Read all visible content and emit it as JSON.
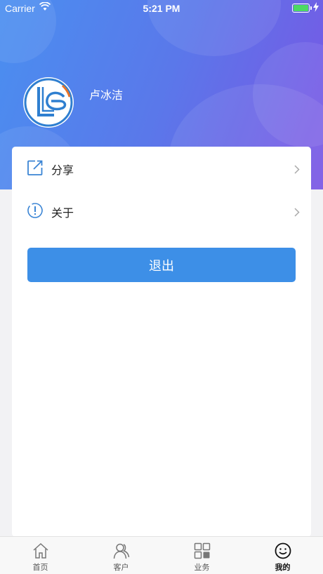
{
  "status_bar": {
    "carrier": "Carrier",
    "time": "5:21 PM",
    "battery_percent": 100
  },
  "profile": {
    "user_name": "卢冰洁",
    "avatar_icon": "company-logo-icon"
  },
  "menu": {
    "items": [
      {
        "label": "分享",
        "icon": "share-icon"
      },
      {
        "label": "关于",
        "icon": "info-icon"
      }
    ]
  },
  "logout_label": "退出",
  "tabbar": {
    "items": [
      {
        "label": "首页",
        "icon": "home-icon"
      },
      {
        "label": "客户",
        "icon": "customers-icon"
      },
      {
        "label": "业务",
        "icon": "business-grid-icon"
      },
      {
        "label": "我的",
        "icon": "smiley-icon",
        "active": true
      }
    ]
  },
  "colors": {
    "accent": "#3d8fe7",
    "header_gradient_start": "#4a8ff0",
    "header_gradient_end": "#7a55e4",
    "icon_blue": "#3a84d4"
  }
}
